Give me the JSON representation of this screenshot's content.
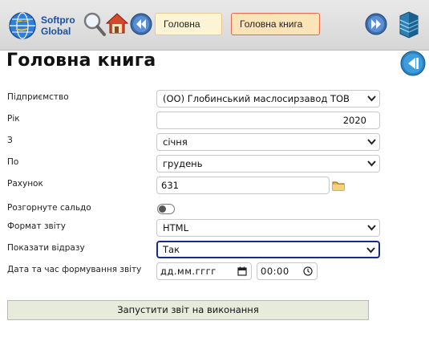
{
  "brand": {
    "line1": "Softpro",
    "line2": "Global"
  },
  "toolbar": {
    "icons": [
      "search-icon",
      "home-icon",
      "back-nav-icon",
      "forward-nav-icon",
      "database-icon"
    ]
  },
  "nav_tabs": [
    {
      "label": "Головна"
    },
    {
      "label": "Головна книга"
    }
  ],
  "page": {
    "title": "Головна книга"
  },
  "form": {
    "enterprise": {
      "label": "Підприємство",
      "value": "(ОО) Глобинський маслосирзавод ТОВ"
    },
    "year": {
      "label": "Рік",
      "value": "2020"
    },
    "from": {
      "label": "З",
      "value": "січня"
    },
    "to": {
      "label": "По",
      "value": "грудень"
    },
    "account": {
      "label": "Рахунок",
      "value": "631"
    },
    "expand_balance": {
      "label": "Розгорнуте сальдо",
      "checked": false
    },
    "report_format": {
      "label": "Формат звіту",
      "value": "HTML"
    },
    "show_now": {
      "label": "Показати відразу",
      "value": "Так"
    },
    "datetime": {
      "label": "Дата та час формування звіту",
      "date_placeholder": "дд.мм.гггг",
      "time_value": "00:00"
    }
  },
  "actions": {
    "run_label": "Запустити звіт на виконання"
  },
  "colors": {
    "accent_border": "#e46a4a",
    "focus_border": "#1a2a88",
    "run_button_bg": "#e6ebdc"
  }
}
